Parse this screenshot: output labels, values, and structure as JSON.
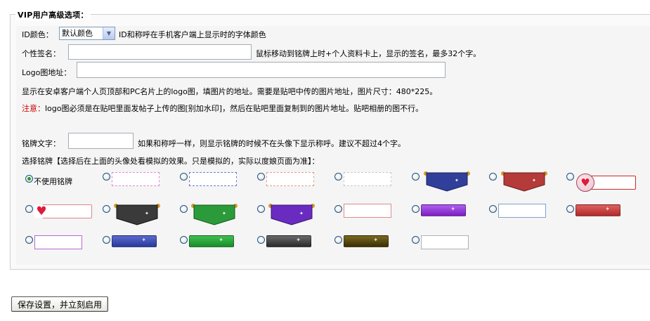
{
  "legend": "VIP用户高级选项：",
  "id_color": {
    "label": "ID颜色：",
    "selected": "默认颜色",
    "hint": "ID和称呼在手机客户端上显示时的字体颜色"
  },
  "signature": {
    "label": "个性签名：",
    "value": "",
    "hint": "鼠标移动到铭牌上时+个人资料卡上，显示的签名，最多32个字。"
  },
  "logo": {
    "label": "Logo图地址：",
    "value": "",
    "desc": "显示在安卓客户端个人页顶部和PC名片上的logo图，填图片的地址。需要是贴吧中传的图片地址，图片尺寸：480*225。",
    "note_label": "注意：",
    "note_text": "logo图必须是在贴吧里面发帖子上传的图[别加水印]，然后在贴吧里面复制到的图片地址。贴吧相册的图不行。"
  },
  "badge_text": {
    "label": "铭牌文字：",
    "value": "",
    "hint": "如果和称呼一样，则显示铭牌的时候不在头像下显示称呼。建议不超过4个字。"
  },
  "badge_select": {
    "label": "选择铭牌【选择后在上面的头像处看模拟的效果。只是模拟的，实际以度娘页面为准】：",
    "none_label": "不使用铭牌"
  },
  "styles": {
    "pink_dashed": "#d98ad9",
    "blue_dashed": "#6a7bd0",
    "salmon_dashed": "#e89a8a",
    "gray_dashed": "#c8c8c8",
    "navy_banner": "#2f3f9a",
    "red_banner": "#b53a3a",
    "black_banner": "#3a3a3a",
    "green_banner": "#2b9a3a",
    "purple_banner": "#6a2bc0",
    "salmon_box": "#e08a8a",
    "purple_bar": "#8a2ad0",
    "blue_box": "#7fa0cf",
    "red_bar": "#c84040",
    "violet_box": "#b46ad0",
    "navy_bar": "#3a4aa8",
    "green_bar": "#2a9a3a",
    "dark_bar": "#444444",
    "olive_bar": "#5a4a10",
    "gray_box": "#b0b0b0"
  },
  "save_button": "保存设置，并立刻启用"
}
